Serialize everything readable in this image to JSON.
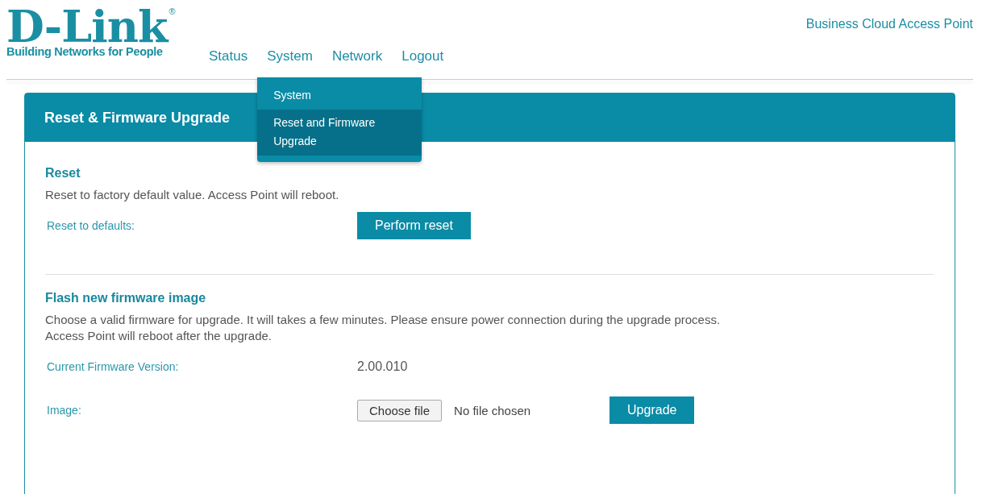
{
  "logo": {
    "wordmark": "D-Link",
    "registered": "®",
    "tagline": "Building Networks for People"
  },
  "product": "Business Cloud Access Point",
  "nav": [
    {
      "label": "Status"
    },
    {
      "label": "System",
      "menu": [
        {
          "label": "System",
          "selected": false
        },
        {
          "label": "Reset and Firmware Upgrade",
          "selected": true
        }
      ]
    },
    {
      "label": "Network"
    },
    {
      "label": "Logout"
    }
  ],
  "panel": {
    "title": "Reset & Firmware Upgrade",
    "sections": [
      {
        "heading": "Reset",
        "description": [
          "Reset to factory default value. Access Point will reboot."
        ],
        "rows": [
          {
            "kind": "button",
            "label": "Reset to defaults:",
            "button": "Perform reset"
          }
        ]
      },
      {
        "heading": "Flash new firmware image",
        "description": [
          "Choose a valid firmware for upgrade. It will takes a few minutes. Please ensure power connection during the upgrade process.",
          "Access Point will reboot after the upgrade."
        ],
        "rows": [
          {
            "kind": "text",
            "label": "Current Firmware Version:",
            "value": "2.00.010"
          },
          {
            "kind": "file",
            "label": "Image:",
            "button": "Choose file",
            "status": "No file chosen",
            "action": "Upgrade"
          }
        ]
      }
    ]
  }
}
